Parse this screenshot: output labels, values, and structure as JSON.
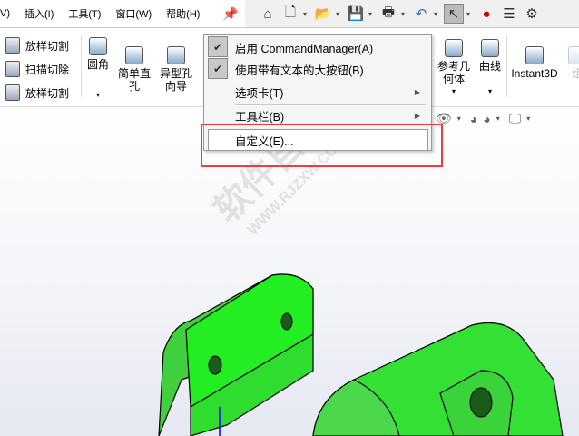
{
  "menubar": {
    "items": [
      "V)",
      "插入(I)",
      "工具(T)",
      "窗口(W)",
      "帮助(H)"
    ]
  },
  "ribbon": {
    "small": [
      "放样切割",
      "扫描切除",
      "放样切割"
    ],
    "fillet": "圆角",
    "simple_hole": "简单直\n孔",
    "hole_wizard": "异型孔\n向导",
    "ref_geom": "参考几\n何体",
    "curves": "曲线",
    "instant3d": "Instant3D",
    "assembly": "组"
  },
  "context_menu": {
    "items": [
      {
        "label": "启用 CommandManager(A)",
        "checked": true
      },
      {
        "label": "使用带有文本的大按钮(B)",
        "checked": true
      },
      {
        "label": "选项卡(T)",
        "submenu": true
      },
      {
        "label": "工具栏(B)",
        "submenu": true
      },
      {
        "label": "自定义(E)..."
      }
    ]
  },
  "watermark": {
    "title": "软件自学网",
    "url": "WWW.RJZXW.COM"
  },
  "colors": {
    "part": "#22ee22",
    "highlight": "#f03c3c"
  }
}
